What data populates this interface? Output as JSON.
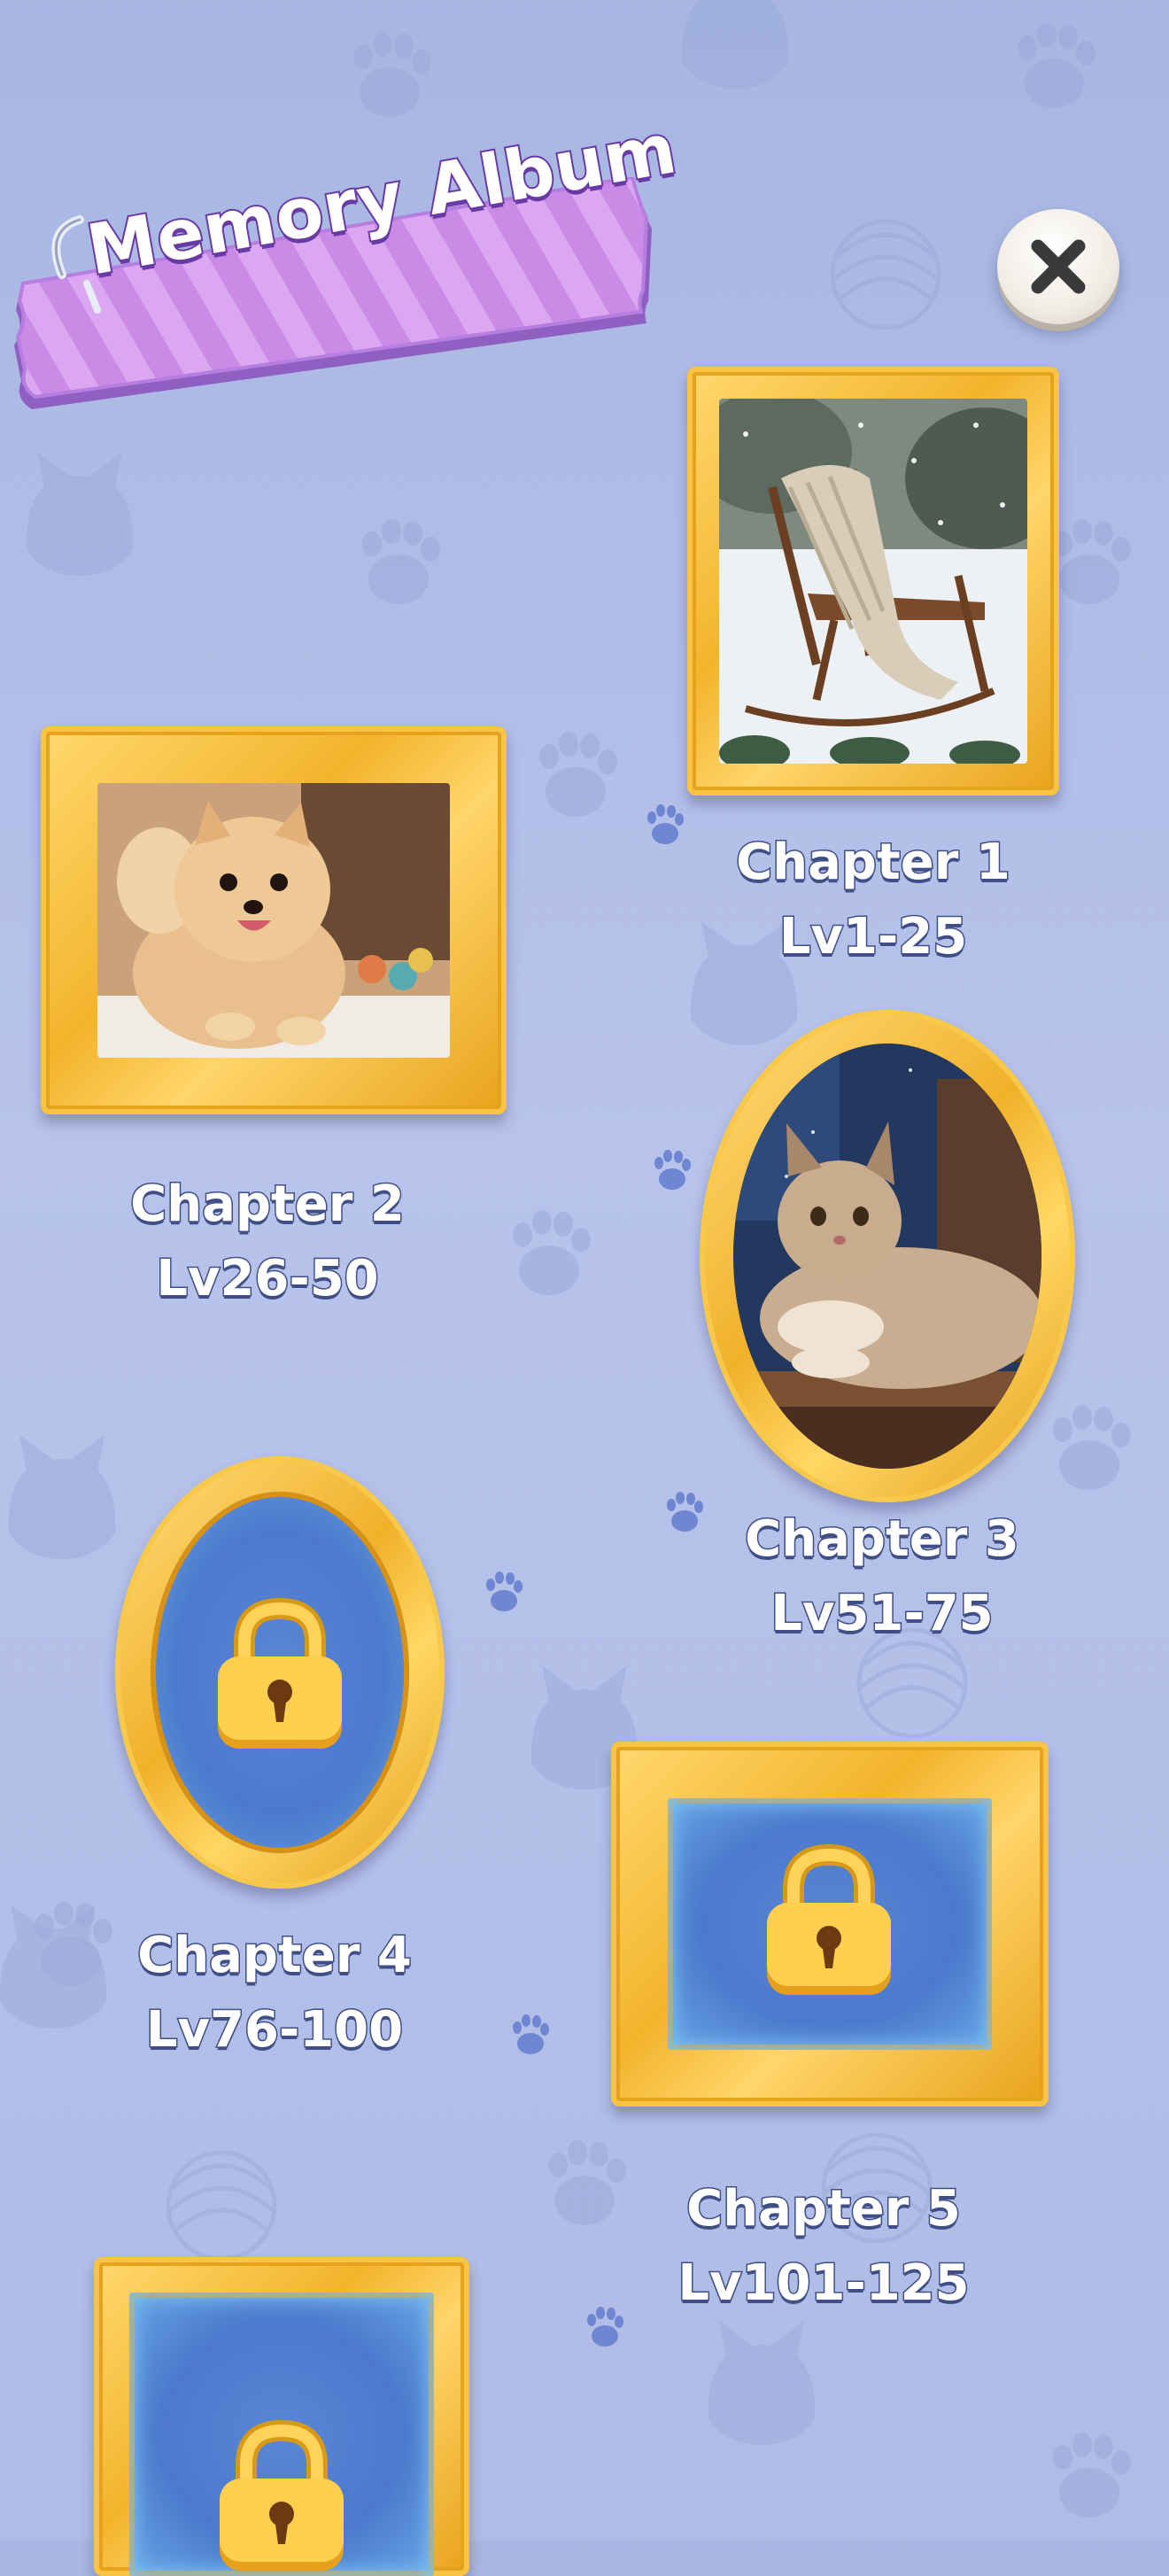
{
  "header": {
    "title": "Memory Album",
    "close_icon": "close-icon"
  },
  "chapters": [
    {
      "name": "Chapter 1",
      "levels": "Lv1-25",
      "locked": false,
      "picture": "rocking-chair-in-snow"
    },
    {
      "name": "Chapter 2",
      "levels": "Lv26-50",
      "locked": false,
      "picture": "pomeranian-puppy"
    },
    {
      "name": "Chapter 3",
      "levels": "Lv51-75",
      "locked": false,
      "picture": "fluffy-cat-on-books"
    },
    {
      "name": "Chapter 4",
      "levels": "Lv76-100",
      "locked": true,
      "picture": "lock-icon"
    },
    {
      "name": "Chapter 5",
      "levels": "Lv101-125",
      "locked": true,
      "picture": "lock-icon"
    },
    {
      "name": "",
      "levels": "",
      "locked": true,
      "picture": "lock-icon"
    }
  ],
  "colors": {
    "background": "#aebce6",
    "frame_gold": "#f3b42c",
    "banner_purple": "#c98be6",
    "locked_blue": "#4b79cc",
    "label_outline": "#3f4f86"
  }
}
